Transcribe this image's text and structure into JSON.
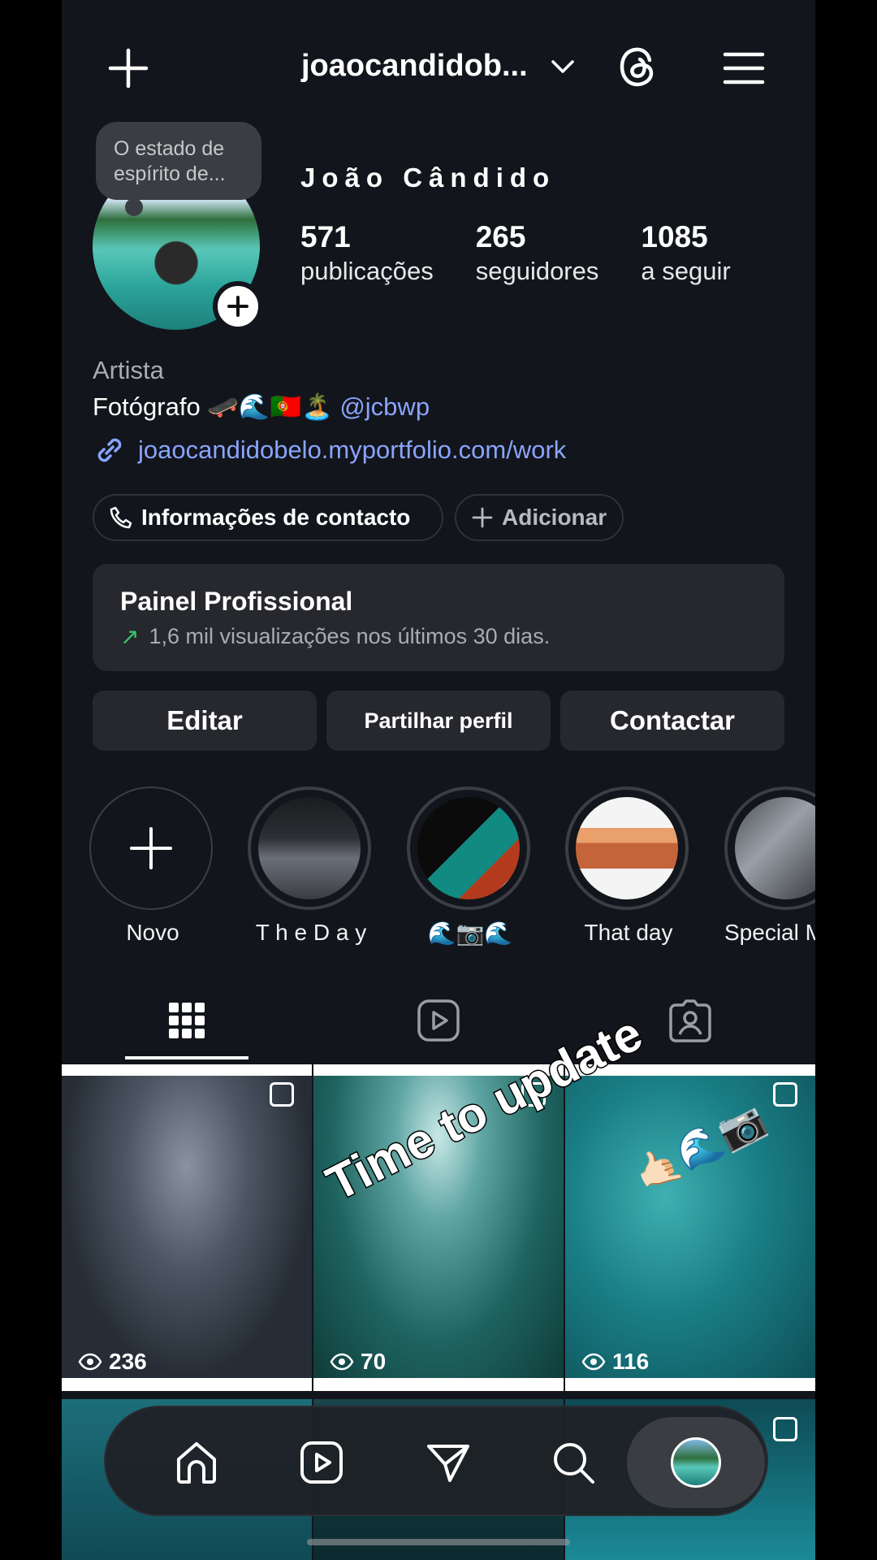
{
  "header": {
    "username": "joaocandidob...",
    "create_icon": "plus-icon",
    "threads_icon": "threads-icon",
    "menu_icon": "hamburger-menu-icon"
  },
  "profile": {
    "note": "O estado de espírito de...",
    "display_name": "João Cândido",
    "stats": [
      {
        "value": "571",
        "label": "publicações"
      },
      {
        "value": "265",
        "label": "seguidores"
      },
      {
        "value": "1085",
        "label": "a seguir"
      }
    ],
    "category": "Artista",
    "bio_text": "Fotógrafo 🛹🌊🇵🇹🏝️",
    "bio_mention": "@jcbwp",
    "link": "joaocandidobelo.myportfolio.com/work"
  },
  "chips": {
    "contact": "Informações de contacto",
    "add": "Adicionar"
  },
  "dashboard": {
    "title": "Painel Profissional",
    "subtitle": "1,6 mil visualizações nos últimos 30 dias."
  },
  "actions": {
    "edit": "Editar",
    "share": "Partilhar perfil",
    "contact": "Contactar"
  },
  "highlights": [
    {
      "label": "Novo"
    },
    {
      "label": "T h e D a y"
    },
    {
      "label": "🌊📷🌊"
    },
    {
      "label": "That day"
    },
    {
      "label": "Special M"
    }
  ],
  "tabs": [
    "grid-icon",
    "reels-icon",
    "tagged-icon"
  ],
  "posts": [
    {
      "views": "236"
    },
    {
      "views": "70"
    },
    {
      "views": "116"
    }
  ],
  "overlay": {
    "text": "Time to update",
    "emoji": "🤙🏻🌊📷"
  },
  "nav": [
    "home-icon",
    "reels-icon",
    "direct-icon",
    "search-icon",
    "profile-avatar"
  ],
  "colors": {
    "background": "#12151b",
    "card": "#26282d",
    "link": "#8aa4ff",
    "trend_up": "#37c26a"
  }
}
